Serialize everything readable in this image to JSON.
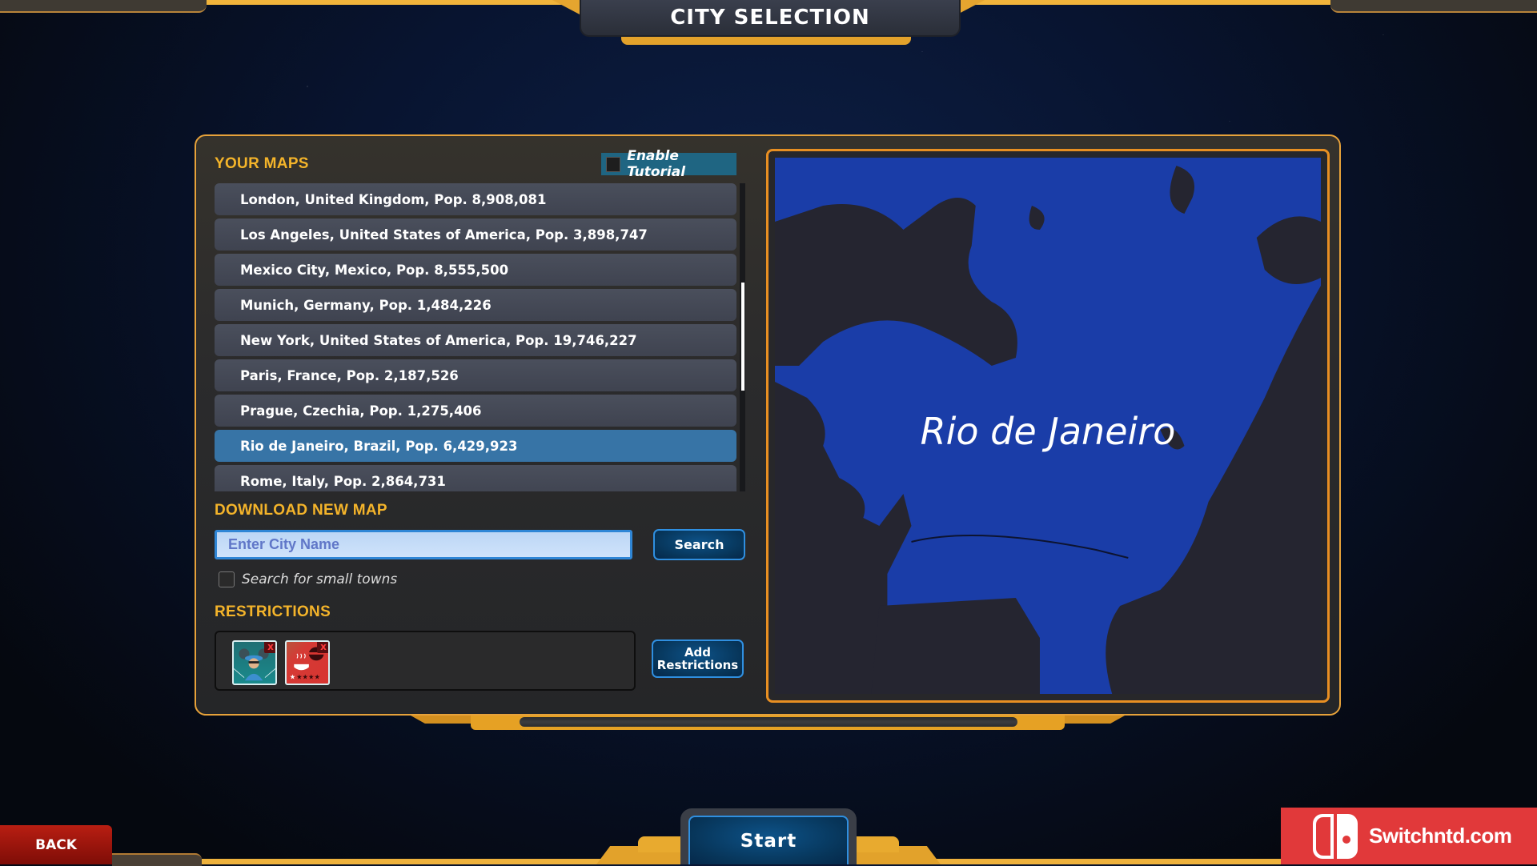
{
  "header": {
    "title": "CITY SELECTION"
  },
  "your_maps": {
    "title": "YOUR MAPS",
    "tutorial_label": "Enable Tutorial",
    "tutorial_checked": false,
    "items": [
      {
        "label": "London, United Kingdom, Pop. 8,908,081",
        "selected": false
      },
      {
        "label": "Los Angeles, United States of America, Pop. 3,898,747",
        "selected": false
      },
      {
        "label": "Mexico City, Mexico, Pop. 8,555,500",
        "selected": false
      },
      {
        "label": "Munich, Germany, Pop. 1,484,226",
        "selected": false
      },
      {
        "label": "New York, United States of America, Pop. 19,746,227",
        "selected": false
      },
      {
        "label": "Paris, France, Pop. 2,187,526",
        "selected": false
      },
      {
        "label": "Prague, Czechia, Pop. 1,275,406",
        "selected": false
      },
      {
        "label": "Rio de Janeiro, Brazil, Pop. 6,429,923",
        "selected": true
      },
      {
        "label": "Rome, Italy, Pop. 2,864,731",
        "selected": false
      }
    ]
  },
  "download": {
    "title": "DOWNLOAD NEW MAP",
    "input_placeholder": "Enter City Name",
    "input_value": "",
    "search_label": "Search",
    "small_towns_label": "Search for small towns",
    "small_towns_checked": false
  },
  "restrictions": {
    "title": "RESTRICTIONS",
    "add_label": "Add Restrictions",
    "items": [
      {
        "icon": "police-icon",
        "remove": "x"
      },
      {
        "icon": "restaurant-one-star-icon",
        "remove": "x"
      }
    ]
  },
  "map_preview": {
    "city_name": "Rio de Janeiro"
  },
  "footer": {
    "back_label": "BACK",
    "start_label": "Start",
    "watermark": "Switchntd.com"
  },
  "colors": {
    "accent_gold": "#f4b42a",
    "selected_row": "#3774a6",
    "water": "#1a3da8",
    "frame_orange": "#e88f22"
  }
}
